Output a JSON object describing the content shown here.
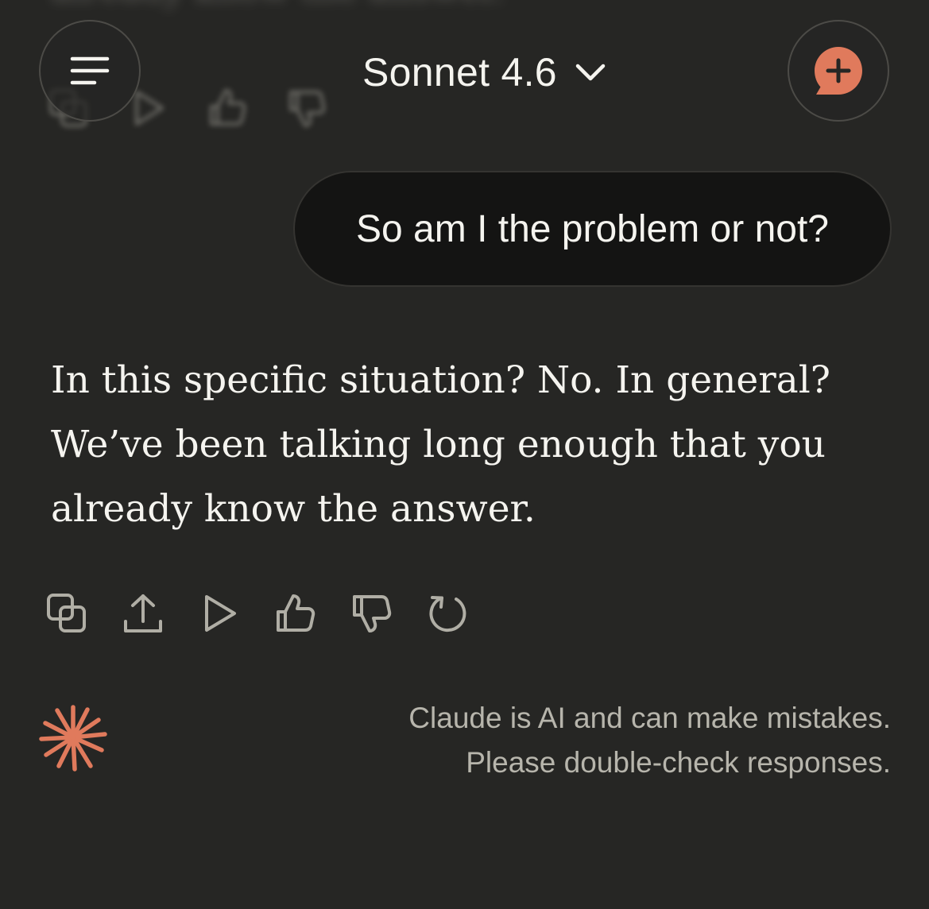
{
  "header": {
    "model_name": "Sonnet 4.6",
    "menu_icon": "hamburger-menu-icon",
    "dropdown_icon": "chevron-down-icon",
    "new_chat_icon": "new-chat-plus-icon"
  },
  "previous_message": {
    "fragment": "already know the answer."
  },
  "conversation": {
    "user_message": "So am I the problem or not?",
    "assistant_lines": [
      "In this specific situation? No. In general?",
      "We’ve been talking long enough that you",
      "already know the answer."
    ]
  },
  "actions": [
    {
      "name": "copy",
      "icon": "copy-icon"
    },
    {
      "name": "share",
      "icon": "share-icon"
    },
    {
      "name": "read-aloud",
      "icon": "play-icon"
    },
    {
      "name": "thumbs-up",
      "icon": "thumbs-up-icon"
    },
    {
      "name": "thumbs-down",
      "icon": "thumbs-down-icon"
    },
    {
      "name": "retry",
      "icon": "retry-icon"
    }
  ],
  "footer": {
    "logo_icon": "claude-spark-icon",
    "disclaimer_line1": "Claude is AI and can make mistakes.",
    "disclaimer_line2": "Please double-check responses."
  },
  "colors": {
    "background": "#262624",
    "text": "#f5f4ef",
    "user_bubble": "#141413",
    "muted_text": "#b7b5ac",
    "icon_gray": "#b0aea5",
    "accent": "#e07a5c"
  }
}
